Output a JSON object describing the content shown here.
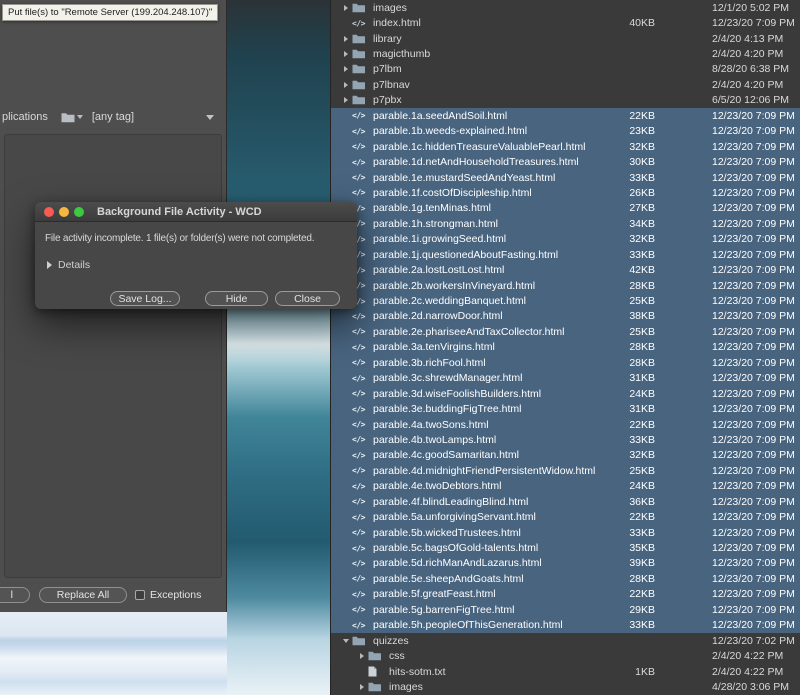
{
  "tooltip": {
    "text": "Put file(s) to \"Remote Server (199.204.248.107)\""
  },
  "left_panel": {
    "applications_label": "plications",
    "tag_filter_value": "[any tag]",
    "partial_button_label": "l",
    "replace_all_label": "Replace All",
    "exceptions_label": "Exceptions"
  },
  "dialog": {
    "title": "Background File Activity - WCD",
    "message": "File activity incomplete. 1 file(s) or folder(s) were not completed.",
    "details_label": "Details",
    "save_log_label": "Save Log...",
    "hide_label": "Hide",
    "close_label": "Close"
  },
  "colors": {
    "selection_blue": "#48647f",
    "panel_background": "#3a3a3a",
    "left_panel_gray": "#4e4e4e"
  },
  "file_panel": {
    "rows": [
      {
        "name": "images",
        "type": "folder",
        "size": "",
        "date": "12/1/20 5:02 PM",
        "selected": false,
        "indent": 0,
        "expanded": false
      },
      {
        "name": "index.html",
        "type": "html",
        "size": "40KB",
        "date": "12/23/20 7:09 PM",
        "selected": false,
        "indent": 0
      },
      {
        "name": "library",
        "type": "folder",
        "size": "",
        "date": "2/4/20 4:13 PM",
        "selected": false,
        "indent": 0,
        "expanded": false
      },
      {
        "name": "magicthumb",
        "type": "folder",
        "size": "",
        "date": "2/4/20 4:20 PM",
        "selected": false,
        "indent": 0,
        "expanded": false
      },
      {
        "name": "p7lbm",
        "type": "folder",
        "size": "",
        "date": "8/28/20 6:38 PM",
        "selected": false,
        "indent": 0,
        "expanded": false
      },
      {
        "name": "p7lbnav",
        "type": "folder",
        "size": "",
        "date": "2/4/20 4:20 PM",
        "selected": false,
        "indent": 0,
        "expanded": false
      },
      {
        "name": "p7pbx",
        "type": "folder",
        "size": "",
        "date": "6/5/20 12:06 PM",
        "selected": false,
        "indent": 0,
        "expanded": false
      },
      {
        "name": "parable.1a.seedAndSoil.html",
        "type": "html",
        "size": "22KB",
        "date": "12/23/20 7:09 PM",
        "selected": true,
        "indent": 0
      },
      {
        "name": "parable.1b.weeds-explained.html",
        "type": "html",
        "size": "23KB",
        "date": "12/23/20 7:09 PM",
        "selected": true,
        "indent": 0
      },
      {
        "name": "parable.1c.hiddenTreasureValuablePearl.html",
        "type": "html",
        "size": "32KB",
        "date": "12/23/20 7:09 PM",
        "selected": true,
        "indent": 0
      },
      {
        "name": "parable.1d.netAndHouseholdTreasures.html",
        "type": "html",
        "size": "30KB",
        "date": "12/23/20 7:09 PM",
        "selected": true,
        "indent": 0
      },
      {
        "name": "parable.1e.mustardSeedAndYeast.html",
        "type": "html",
        "size": "33KB",
        "date": "12/23/20 7:09 PM",
        "selected": true,
        "indent": 0
      },
      {
        "name": "parable.1f.costOfDiscipleship.html",
        "type": "html",
        "size": "26KB",
        "date": "12/23/20 7:09 PM",
        "selected": true,
        "indent": 0
      },
      {
        "name": "parable.1g.tenMinas.html",
        "type": "html",
        "size": "27KB",
        "date": "12/23/20 7:09 PM",
        "selected": true,
        "indent": 0
      },
      {
        "name": "parable.1h.strongman.html",
        "type": "html",
        "size": "34KB",
        "date": "12/23/20 7:09 PM",
        "selected": true,
        "indent": 0
      },
      {
        "name": "parable.1i.growingSeed.html",
        "type": "html",
        "size": "32KB",
        "date": "12/23/20 7:09 PM",
        "selected": true,
        "indent": 0
      },
      {
        "name": "parable.1j.questionedAboutFasting.html",
        "type": "html",
        "size": "33KB",
        "date": "12/23/20 7:09 PM",
        "selected": true,
        "indent": 0
      },
      {
        "name": "parable.2a.lostLostLost.html",
        "type": "html",
        "size": "42KB",
        "date": "12/23/20 7:09 PM",
        "selected": true,
        "indent": 0
      },
      {
        "name": "parable.2b.workersInVineyard.html",
        "type": "html",
        "size": "28KB",
        "date": "12/23/20 7:09 PM",
        "selected": true,
        "indent": 0
      },
      {
        "name": "parable.2c.weddingBanquet.html",
        "type": "html",
        "size": "25KB",
        "date": "12/23/20 7:09 PM",
        "selected": true,
        "indent": 0
      },
      {
        "name": "parable.2d.narrowDoor.html",
        "type": "html",
        "size": "38KB",
        "date": "12/23/20 7:09 PM",
        "selected": true,
        "indent": 0
      },
      {
        "name": "parable.2e.phariseeAndTaxCollector.html",
        "type": "html",
        "size": "25KB",
        "date": "12/23/20 7:09 PM",
        "selected": true,
        "indent": 0
      },
      {
        "name": "parable.3a.tenVirgins.html",
        "type": "html",
        "size": "28KB",
        "date": "12/23/20 7:09 PM",
        "selected": true,
        "indent": 0
      },
      {
        "name": "parable.3b.richFool.html",
        "type": "html",
        "size": "28KB",
        "date": "12/23/20 7:09 PM",
        "selected": true,
        "indent": 0
      },
      {
        "name": "parable.3c.shrewdManager.html",
        "type": "html",
        "size": "31KB",
        "date": "12/23/20 7:09 PM",
        "selected": true,
        "indent": 0
      },
      {
        "name": "parable.3d.wiseFoolishBuilders.html",
        "type": "html",
        "size": "24KB",
        "date": "12/23/20 7:09 PM",
        "selected": true,
        "indent": 0
      },
      {
        "name": "parable.3e.buddingFigTree.html",
        "type": "html",
        "size": "31KB",
        "date": "12/23/20 7:09 PM",
        "selected": true,
        "indent": 0
      },
      {
        "name": "parable.4a.twoSons.html",
        "type": "html",
        "size": "22KB",
        "date": "12/23/20 7:09 PM",
        "selected": true,
        "indent": 0
      },
      {
        "name": "parable.4b.twoLamps.html",
        "type": "html",
        "size": "33KB",
        "date": "12/23/20 7:09 PM",
        "selected": true,
        "indent": 0
      },
      {
        "name": "parable.4c.goodSamaritan.html",
        "type": "html",
        "size": "32KB",
        "date": "12/23/20 7:09 PM",
        "selected": true,
        "indent": 0
      },
      {
        "name": "parable.4d.midnightFriendPersistentWidow.html",
        "type": "html",
        "size": "25KB",
        "date": "12/23/20 7:09 PM",
        "selected": true,
        "indent": 0
      },
      {
        "name": "parable.4e.twoDebtors.html",
        "type": "html",
        "size": "24KB",
        "date": "12/23/20 7:09 PM",
        "selected": true,
        "indent": 0
      },
      {
        "name": "parable.4f.blindLeadingBlind.html",
        "type": "html",
        "size": "36KB",
        "date": "12/23/20 7:09 PM",
        "selected": true,
        "indent": 0
      },
      {
        "name": "parable.5a.unforgivingServant.html",
        "type": "html",
        "size": "22KB",
        "date": "12/23/20 7:09 PM",
        "selected": true,
        "indent": 0
      },
      {
        "name": "parable.5b.wickedTrustees.html",
        "type": "html",
        "size": "33KB",
        "date": "12/23/20 7:09 PM",
        "selected": true,
        "indent": 0
      },
      {
        "name": "parable.5c.bagsOfGold-talents.html",
        "type": "html",
        "size": "35KB",
        "date": "12/23/20 7:09 PM",
        "selected": true,
        "indent": 0
      },
      {
        "name": "parable.5d.richManAndLazarus.html",
        "type": "html",
        "size": "39KB",
        "date": "12/23/20 7:09 PM",
        "selected": true,
        "indent": 0
      },
      {
        "name": "parable.5e.sheepAndGoats.html",
        "type": "html",
        "size": "28KB",
        "date": "12/23/20 7:09 PM",
        "selected": true,
        "indent": 0
      },
      {
        "name": "parable.5f.greatFeast.html",
        "type": "html",
        "size": "22KB",
        "date": "12/23/20 7:09 PM",
        "selected": true,
        "indent": 0
      },
      {
        "name": "parable.5g.barrenFigTree.html",
        "type": "html",
        "size": "29KB",
        "date": "12/23/20 7:09 PM",
        "selected": true,
        "indent": 0
      },
      {
        "name": "parable.5h.peopleOfThisGeneration.html",
        "type": "html",
        "size": "33KB",
        "date": "12/23/20 7:09 PM",
        "selected": true,
        "indent": 0
      },
      {
        "name": "quizzes",
        "type": "folder",
        "size": "",
        "date": "12/23/20 7:02 PM",
        "selected": false,
        "indent": 0,
        "expanded": true
      },
      {
        "name": "css",
        "type": "folder",
        "size": "",
        "date": "2/4/20 4:22 PM",
        "selected": false,
        "indent": 1,
        "expanded": false
      },
      {
        "name": "hits-sotm.txt",
        "type": "txt",
        "size": "1KB",
        "date": "2/4/20 4:22 PM",
        "selected": false,
        "indent": 1
      },
      {
        "name": "images",
        "type": "folder",
        "size": "",
        "date": "4/28/20 3:06 PM",
        "selected": false,
        "indent": 1,
        "expanded": false
      }
    ]
  }
}
